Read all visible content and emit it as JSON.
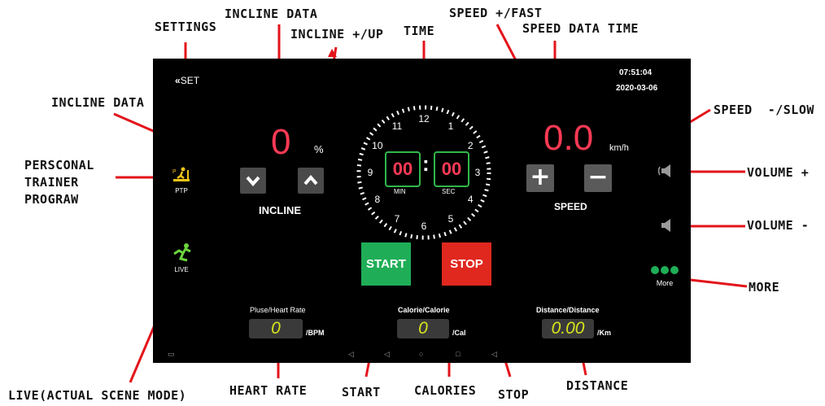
{
  "annotations": {
    "settings": "SETTINGS",
    "incline_data_top": "INCLINE DATA",
    "incline_up": "INCLINE +/UP",
    "time": "TIME",
    "speed_fast": "SPEED +/FAST",
    "speed_data_time": "SPEED DATA TIME",
    "incline_data_left": "INCLINE DATA",
    "speed_slow": "SPEED  -/SLOW",
    "personal_trainer": [
      "PERSCONAL",
      "TRAINER",
      "PROGRAW"
    ],
    "volume_plus": "VOLUME +",
    "volume_minus": "VOLUME -",
    "more": "MORE",
    "live_mode": "LIVE(ACTUAL SCENE MODE)",
    "heart_rate": "HEART RATE",
    "start": "START",
    "calories": "CALORIES",
    "stop": "STOP",
    "distance": "DISTANCE"
  },
  "screen": {
    "set_label": "SET",
    "time": "07:51:04",
    "date": "2020-03-06",
    "incline": {
      "value": "0",
      "unit": "%",
      "label": "INCLINE"
    },
    "speed": {
      "value": "0.0",
      "unit": "km/h",
      "label": "SPEED",
      "plus": "+",
      "minus": "−"
    },
    "clock": {
      "numbers": [
        "12",
        "1",
        "2",
        "3",
        "4",
        "5",
        "6",
        "7",
        "8",
        "9",
        "10",
        "11"
      ],
      "min_value": "00",
      "sec_value": "00",
      "colon": ":",
      "min_label": "MIN",
      "sec_label": "SEC"
    },
    "ptp_label": "PTP",
    "live_label": "LIVE",
    "more_label": "More",
    "start_label": "START",
    "stop_label": "STOP",
    "heart": {
      "title": "Pluse/Heart Rate",
      "value": "0",
      "unit": "/BPM"
    },
    "calorie": {
      "title": "Calorie/Calorie",
      "value": "0",
      "unit": "/Cal"
    },
    "distance": {
      "title": "Distance/Distance",
      "value": "0.00",
      "unit": "/Km"
    }
  },
  "colors": {
    "accent_red": "#ff3a55",
    "start_green": "#1fae57",
    "stop_red": "#e0281e",
    "box_green": "#2fb84b",
    "readout_yellow": "#d8e51b",
    "icon_yellow": "#f0c419"
  }
}
